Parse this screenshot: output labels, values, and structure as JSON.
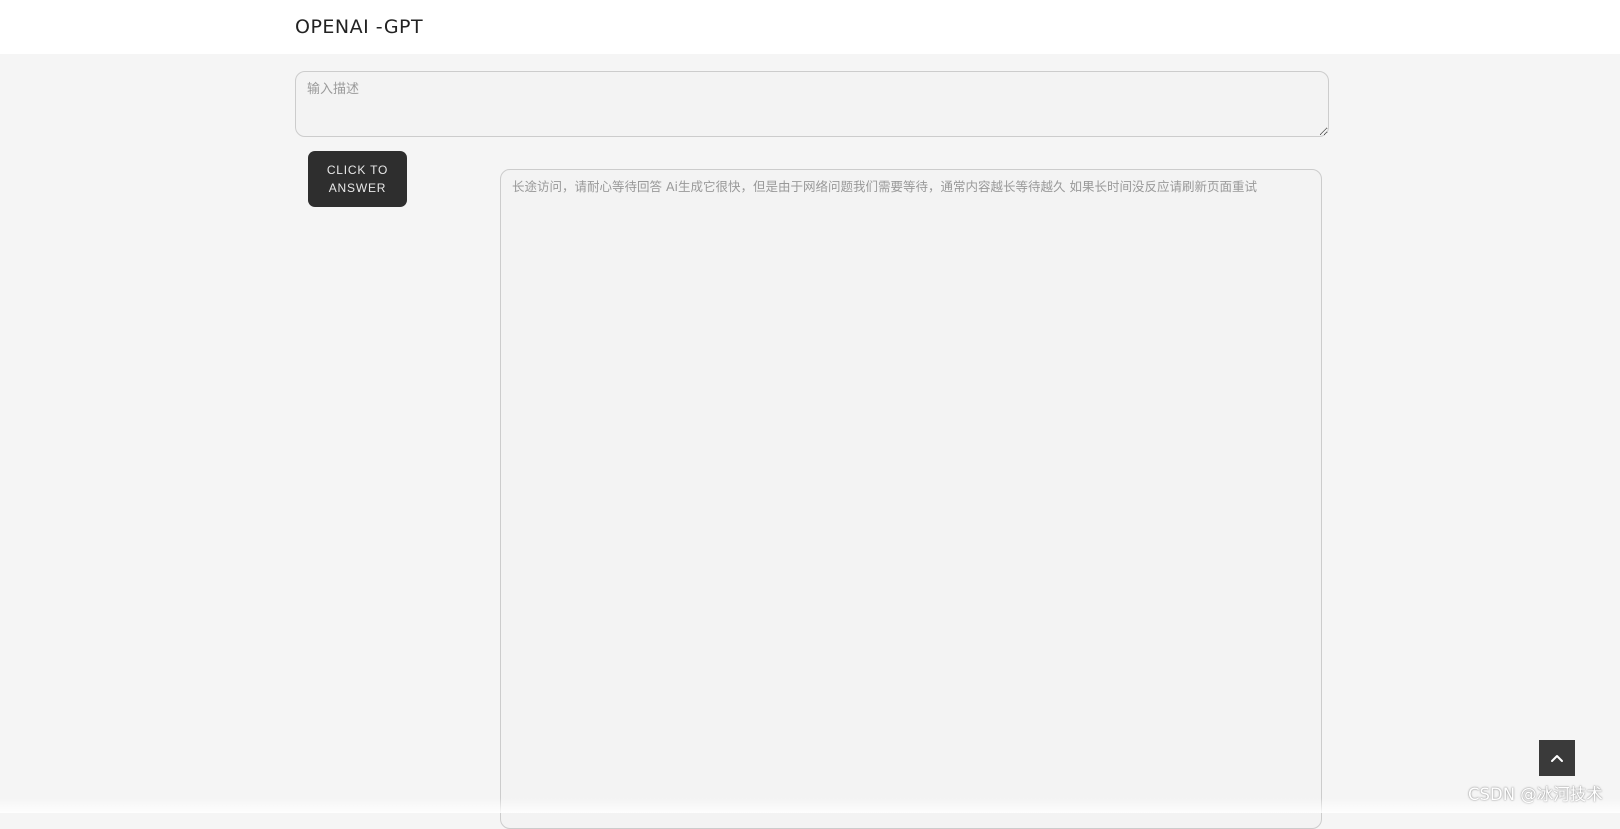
{
  "header": {
    "title": "OPENAI -GPT"
  },
  "prompt": {
    "placeholder": "输入描述",
    "value": ""
  },
  "submit_button": {
    "label": "CLICK TO ANSWER"
  },
  "answer": {
    "placeholder": "长途访问，请耐心等待回答 Ai生成它很快，但是由于网络问题我们需要等待，通常内容越长等待越久 如果长时间没反应请刷新页面重试",
    "value": ""
  },
  "back_to_top": {
    "icon": "chevron-up-icon"
  },
  "watermark": {
    "text": "CSDN @冰河技术"
  },
  "colors": {
    "page_background": "#f5f5f5",
    "header_background": "#ffffff",
    "button_background": "#2e2e2e",
    "button_text": "#e8e8e8",
    "field_background": "#f3f3f3",
    "field_border": "#cccccc",
    "back_to_top_background": "#3a3a3a"
  }
}
